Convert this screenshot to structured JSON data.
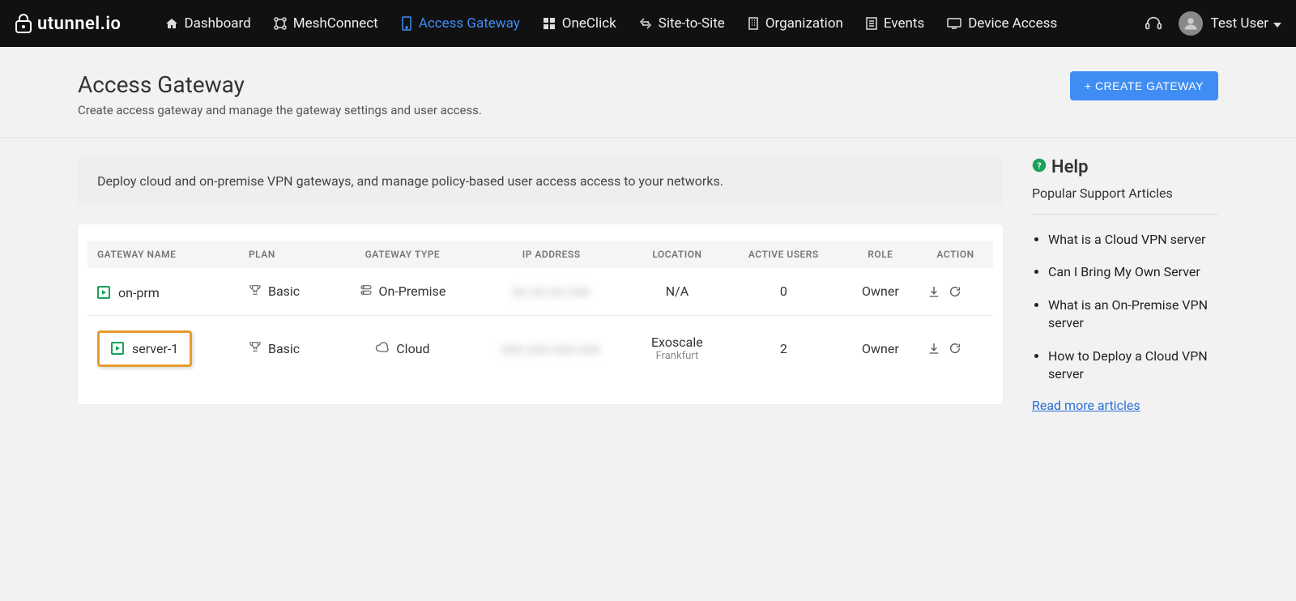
{
  "brand": {
    "name": "utunnel.io"
  },
  "nav": {
    "items": [
      {
        "label": "Dashboard"
      },
      {
        "label": "MeshConnect"
      },
      {
        "label": "Access Gateway",
        "active": true
      },
      {
        "label": "OneClick"
      },
      {
        "label": "Site-to-Site"
      },
      {
        "label": "Organization"
      },
      {
        "label": "Events"
      },
      {
        "label": "Device Access"
      }
    ],
    "user": "Test User"
  },
  "page": {
    "title": "Access Gateway",
    "subtitle": "Create access gateway and manage the gateway settings and user access.",
    "create_btn": "+ CREATE GATEWAY",
    "banner": "Deploy cloud and on-premise VPN gateways, and manage policy-based user access access to your networks."
  },
  "table": {
    "headers": {
      "name": "GATEWAY NAME",
      "plan": "PLAN",
      "type": "GATEWAY TYPE",
      "ip": "IP ADDRESS",
      "location": "LOCATION",
      "users": "ACTIVE USERS",
      "role": "ROLE",
      "action": "ACTION"
    },
    "rows": [
      {
        "name": "on-prm",
        "plan": "Basic",
        "type": "On-Premise",
        "ip": "xx.xx.xx.xxx",
        "location": "N/A",
        "location_sub": "",
        "users": "0",
        "role": "Owner",
        "highlight": false
      },
      {
        "name": "server-1",
        "plan": "Basic",
        "type": "Cloud",
        "ip": "xxx.xxx.xxx.xxx",
        "location": "Exoscale",
        "location_sub": "Frankfurt",
        "users": "2",
        "role": "Owner",
        "highlight": true
      }
    ]
  },
  "help": {
    "title": "Help",
    "subtitle": "Popular Support Articles",
    "articles": [
      "What is a Cloud VPN server",
      "Can I Bring My Own Server",
      "What is an On-Premise VPN server",
      "How to Deploy a Cloud VPN server"
    ],
    "more": "Read more articles"
  }
}
